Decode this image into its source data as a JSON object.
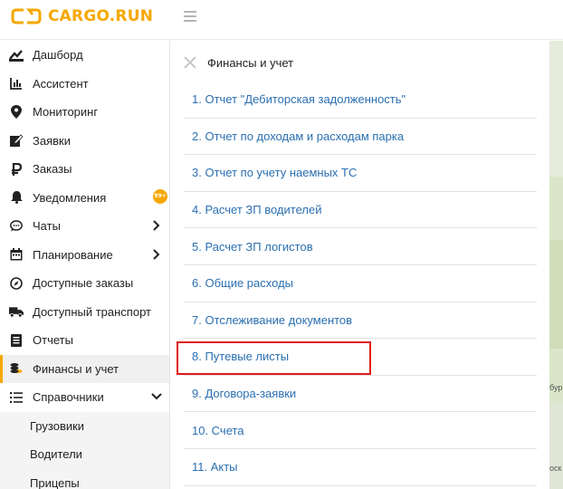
{
  "brand": {
    "name": "CARGO.RUN",
    "accent": "#f5a800"
  },
  "sidebar": {
    "items": [
      {
        "label": "Дашборд",
        "icon": "dashboard-icon"
      },
      {
        "label": "Ассистент",
        "icon": "chart-icon"
      },
      {
        "label": "Мониторинг",
        "icon": "map-pin-icon"
      },
      {
        "label": "Заявки",
        "icon": "edit-icon"
      },
      {
        "label": "Заказы",
        "icon": "ruble-icon"
      },
      {
        "label": "Уведомления",
        "icon": "bell-icon",
        "badge": "99+"
      },
      {
        "label": "Чаты",
        "icon": "chat-icon",
        "chevron": "right"
      },
      {
        "label": "Планирование",
        "icon": "calendar-icon",
        "chevron": "right"
      },
      {
        "label": "Доступные заказы",
        "icon": "compass-icon"
      },
      {
        "label": "Доступный транспорт",
        "icon": "truck-icon"
      },
      {
        "label": "Отчеты",
        "icon": "report-icon"
      },
      {
        "label": "Финансы и учет",
        "icon": "coins-icon",
        "active": true
      },
      {
        "label": "Справочники",
        "icon": "list-icon",
        "chevron": "down"
      }
    ],
    "sub_items": [
      "Грузовики",
      "Водители",
      "Прицепы"
    ]
  },
  "panel": {
    "title": "Финансы и учет",
    "reports": [
      "1. Отчет \"Дебиторская задолженность\"",
      "2. Отчет по доходам и расходам парка",
      "3. Отчет по учету наемных ТС",
      "4. Расчет ЗП водителей",
      "5. Расчет ЗП логистов",
      "6. Общие расходы",
      "7. Отслеживание документов",
      "8. Путевые листы",
      "9. Договора-заявки",
      "10. Счета",
      "11. Акты"
    ],
    "highlighted_index": 7
  },
  "map": {
    "labels": [
      "бур",
      "оск"
    ]
  },
  "colors": {
    "link": "#2a6fb0",
    "highlight_border": "#e01a1a",
    "active_bg": "#f0f0f0"
  }
}
